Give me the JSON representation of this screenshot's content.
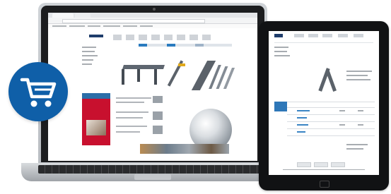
{
  "scene": {
    "description_colors": {
      "badge": "#0f5fa8",
      "promo_red": "#c8102e",
      "accent_blue": "#2e77b8"
    },
    "icons": [
      "shopping-cart-icon"
    ]
  }
}
